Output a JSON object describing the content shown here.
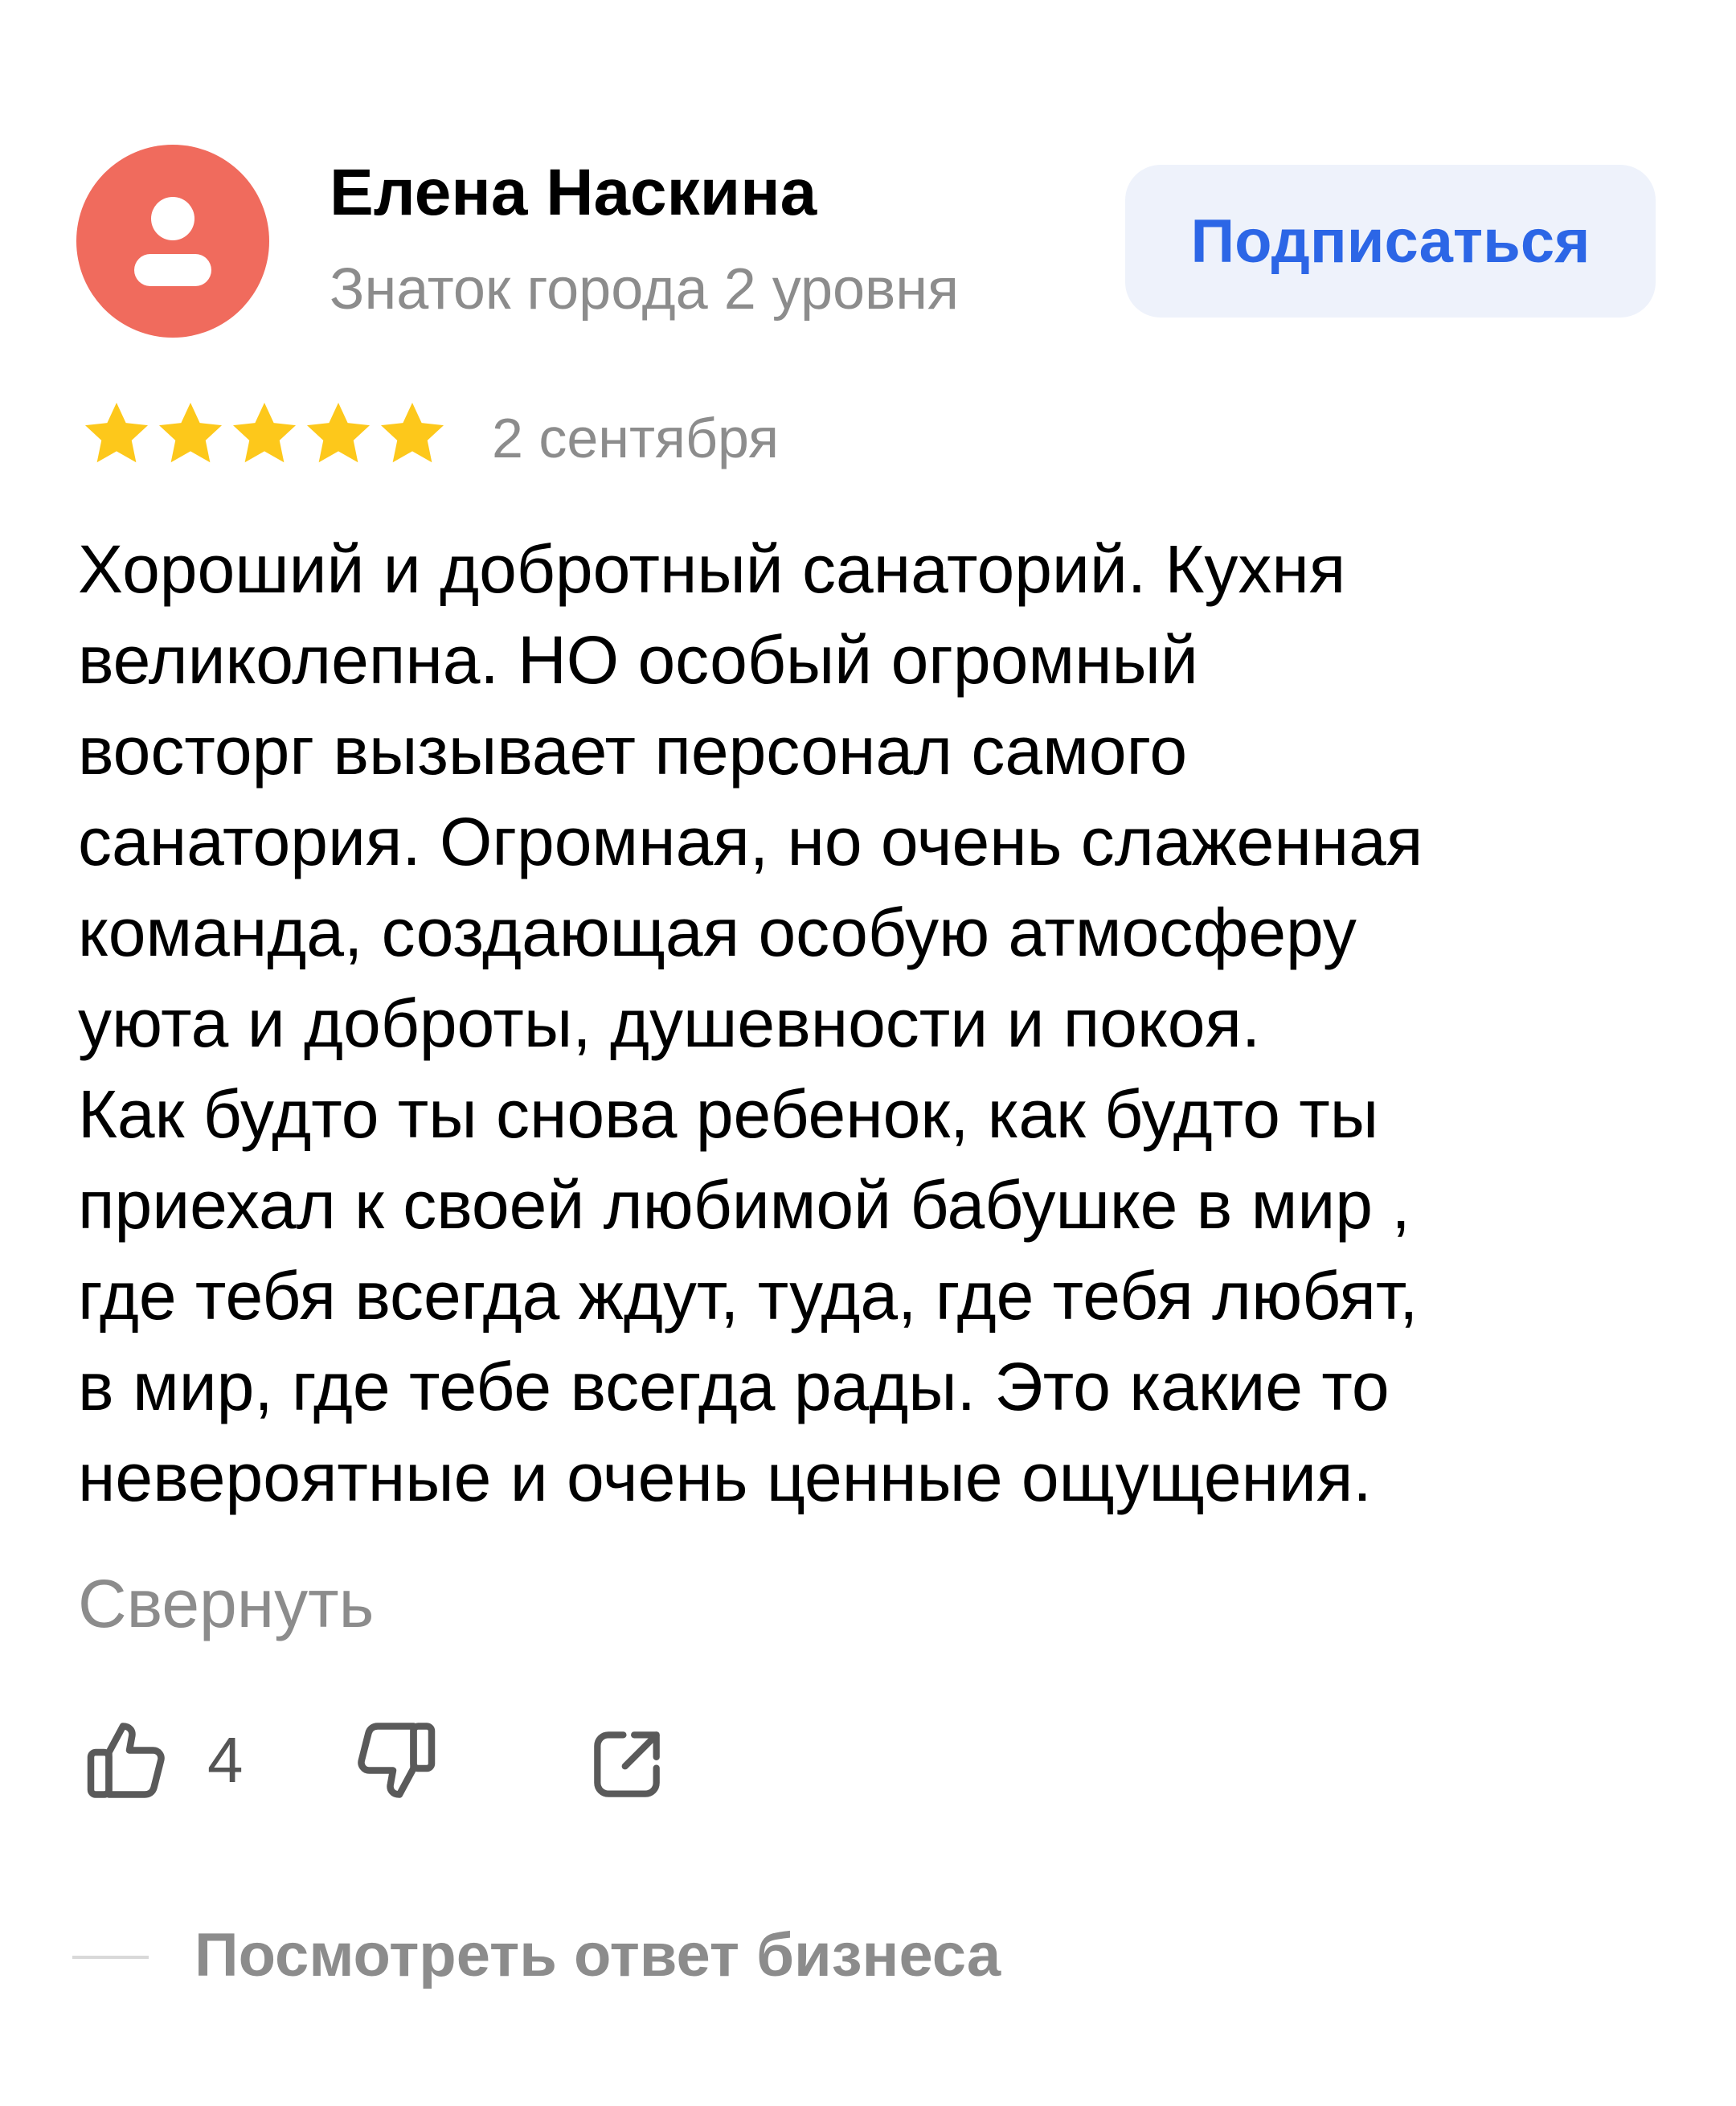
{
  "author": {
    "name": "Елена Наскина",
    "level": "Знаток города 2 уровня",
    "avatar_icon": "user-silhouette-icon",
    "avatar_color": "#f06b5d"
  },
  "subscribe": {
    "label": "Подписаться",
    "color": "#2c66e6",
    "background": "#eef2fb"
  },
  "rating": {
    "value": 5,
    "max": 5,
    "star_color": "#fdc81b"
  },
  "review": {
    "date": "2 сентября",
    "lines": [
      "Хороший и добротный санаторий. Кухня",
      "великолепна. НО особый огромный",
      "восторг вызывает персонал самого",
      "санатория. Огромная, но очень слаженная",
      "команда, создающая особую атмосферу",
      "уюта и доброты, душевности и покоя.",
      "Как будто ты снова ребенок, как будто ты",
      "приехал к своей любимой бабушке в мир ,",
      "где тебя всегда ждут, туда, где тебя любят,",
      "в мир, где тебе всегда рады. Это какие то",
      "невероятные и очень ценные ощущения."
    ],
    "collapse_label": "Свернуть"
  },
  "actions": {
    "like_icon": "thumbs-up-icon",
    "like_count": "4",
    "dislike_icon": "thumbs-down-icon",
    "share_icon": "share-icon"
  },
  "business_reply": {
    "label": "Посмотреть ответ бизнеса"
  }
}
